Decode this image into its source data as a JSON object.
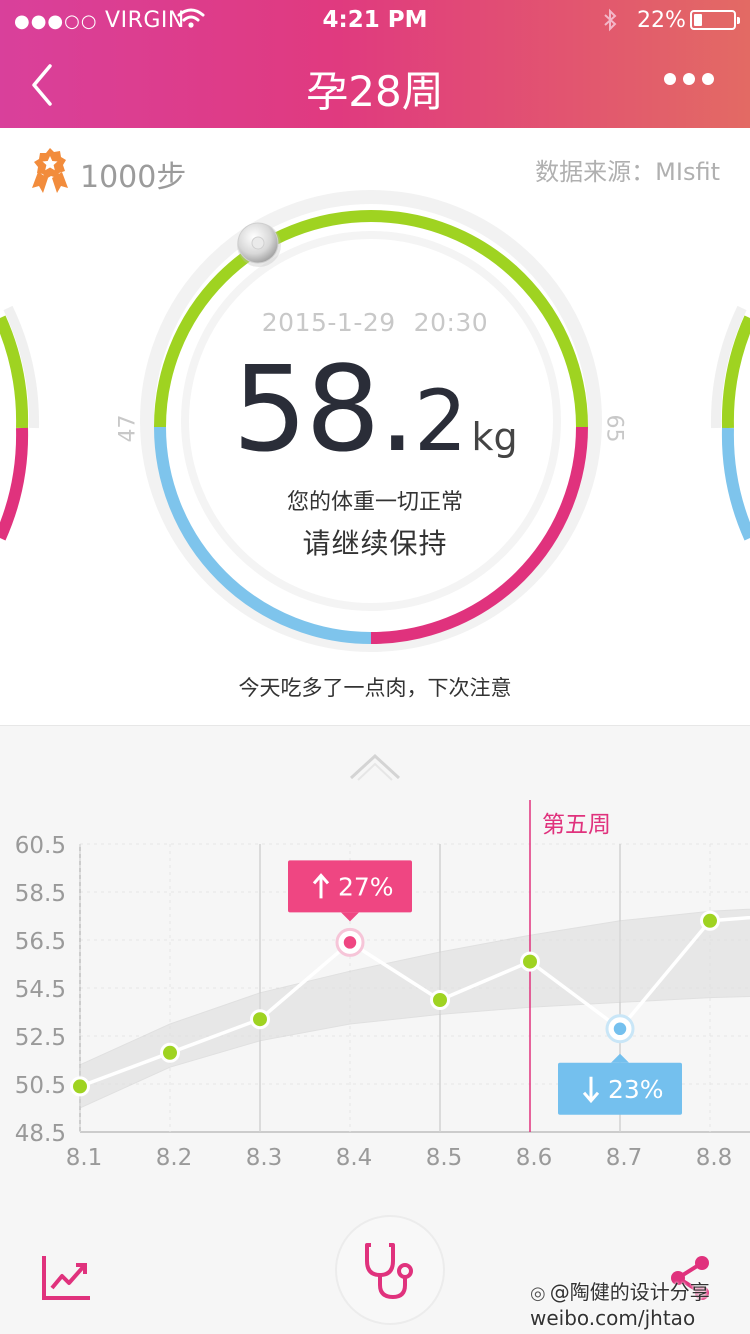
{
  "status_bar": {
    "carrier_dots": "●●●○○",
    "carrier": "VIRGIN",
    "time": "4:21 PM",
    "battery_percent": "22%",
    "battery_level": 0.22,
    "icons": [
      "wifi-icon",
      "bluetooth-icon",
      "battery-icon"
    ]
  },
  "nav": {
    "title": "孕28周",
    "back_icon": "chevron-left-icon",
    "more_icon": "more-dots-icon"
  },
  "card": {
    "steps_icon": "medal-icon",
    "steps_label": "1000步",
    "source_label": "数据来源：MIsfit",
    "date": "2015-1-29",
    "time": "20:30",
    "weight_int": "58.",
    "weight_dec": "2",
    "weight_unit": "kg",
    "range_min": "47",
    "range_max": "65",
    "status_line1": "您的体重一切正常",
    "status_line2": "请继续保持",
    "tip": "今天吃多了一点肉，下次注意",
    "colors": {
      "green": "#9fd321",
      "pink": "#e0327d",
      "blue": "#7ec4ec"
    }
  },
  "expand_icon": "chevron-up-icon",
  "chart_data": {
    "type": "line",
    "categories": [
      "8.1",
      "8.2",
      "8.3",
      "8.4",
      "8.5",
      "8.6",
      "8.7",
      "8.8"
    ],
    "values": [
      50.4,
      51.8,
      53.2,
      56.4,
      54.0,
      55.6,
      52.8,
      57.3,
      57.6
    ],
    "yticks": [
      "60.5",
      "58.5",
      "56.5",
      "54.5",
      "52.5",
      "50.5",
      "48.5"
    ],
    "ylim": [
      48.5,
      60.5
    ],
    "normal_band": {
      "lower": [
        49.5,
        51.2,
        52.3,
        53.0,
        53.4,
        53.7,
        53.9,
        54.1,
        54.2
      ],
      "upper": [
        51.3,
        53.0,
        54.3,
        55.2,
        56.0,
        56.7,
        57.3,
        57.7,
        57.9
      ]
    },
    "week_marker": {
      "label": "第五周",
      "at": "8.6"
    },
    "callout_up": {
      "label": "27%",
      "arrow": "arrow-up-icon",
      "point_index": 3,
      "color": "#ef4682"
    },
    "callout_down": {
      "label": "23%",
      "arrow": "arrow-down-icon",
      "point_index": 6,
      "color": "#74c0ee"
    },
    "line_color": "#ffffff",
    "point_color": "#9fd321",
    "grid": true
  },
  "bottom_bar": {
    "trend_icon": "trend-chart-icon",
    "center_icon": "stethoscope-icon",
    "share_icon": "share-icon"
  },
  "watermark": {
    "line1": "@陶健的设计分享",
    "line2": "weibo.com/jhtao"
  }
}
